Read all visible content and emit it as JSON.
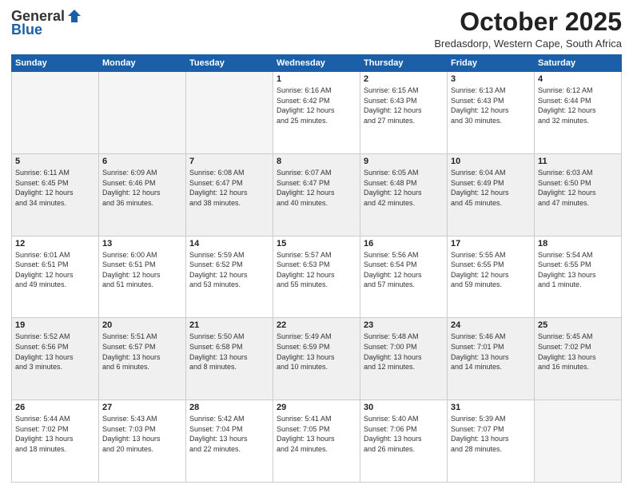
{
  "logo": {
    "line1": "General",
    "line2": "Blue"
  },
  "title": "October 2025",
  "subtitle": "Bredasdorp, Western Cape, South Africa",
  "days_of_week": [
    "Sunday",
    "Monday",
    "Tuesday",
    "Wednesday",
    "Thursday",
    "Friday",
    "Saturday"
  ],
  "weeks": [
    [
      {
        "day": "",
        "info": ""
      },
      {
        "day": "",
        "info": ""
      },
      {
        "day": "",
        "info": ""
      },
      {
        "day": "1",
        "info": "Sunrise: 6:16 AM\nSunset: 6:42 PM\nDaylight: 12 hours\nand 25 minutes."
      },
      {
        "day": "2",
        "info": "Sunrise: 6:15 AM\nSunset: 6:43 PM\nDaylight: 12 hours\nand 27 minutes."
      },
      {
        "day": "3",
        "info": "Sunrise: 6:13 AM\nSunset: 6:43 PM\nDaylight: 12 hours\nand 30 minutes."
      },
      {
        "day": "4",
        "info": "Sunrise: 6:12 AM\nSunset: 6:44 PM\nDaylight: 12 hours\nand 32 minutes."
      }
    ],
    [
      {
        "day": "5",
        "info": "Sunrise: 6:11 AM\nSunset: 6:45 PM\nDaylight: 12 hours\nand 34 minutes."
      },
      {
        "day": "6",
        "info": "Sunrise: 6:09 AM\nSunset: 6:46 PM\nDaylight: 12 hours\nand 36 minutes."
      },
      {
        "day": "7",
        "info": "Sunrise: 6:08 AM\nSunset: 6:47 PM\nDaylight: 12 hours\nand 38 minutes."
      },
      {
        "day": "8",
        "info": "Sunrise: 6:07 AM\nSunset: 6:47 PM\nDaylight: 12 hours\nand 40 minutes."
      },
      {
        "day": "9",
        "info": "Sunrise: 6:05 AM\nSunset: 6:48 PM\nDaylight: 12 hours\nand 42 minutes."
      },
      {
        "day": "10",
        "info": "Sunrise: 6:04 AM\nSunset: 6:49 PM\nDaylight: 12 hours\nand 45 minutes."
      },
      {
        "day": "11",
        "info": "Sunrise: 6:03 AM\nSunset: 6:50 PM\nDaylight: 12 hours\nand 47 minutes."
      }
    ],
    [
      {
        "day": "12",
        "info": "Sunrise: 6:01 AM\nSunset: 6:51 PM\nDaylight: 12 hours\nand 49 minutes."
      },
      {
        "day": "13",
        "info": "Sunrise: 6:00 AM\nSunset: 6:51 PM\nDaylight: 12 hours\nand 51 minutes."
      },
      {
        "day": "14",
        "info": "Sunrise: 5:59 AM\nSunset: 6:52 PM\nDaylight: 12 hours\nand 53 minutes."
      },
      {
        "day": "15",
        "info": "Sunrise: 5:57 AM\nSunset: 6:53 PM\nDaylight: 12 hours\nand 55 minutes."
      },
      {
        "day": "16",
        "info": "Sunrise: 5:56 AM\nSunset: 6:54 PM\nDaylight: 12 hours\nand 57 minutes."
      },
      {
        "day": "17",
        "info": "Sunrise: 5:55 AM\nSunset: 6:55 PM\nDaylight: 12 hours\nand 59 minutes."
      },
      {
        "day": "18",
        "info": "Sunrise: 5:54 AM\nSunset: 6:55 PM\nDaylight: 13 hours\nand 1 minute."
      }
    ],
    [
      {
        "day": "19",
        "info": "Sunrise: 5:52 AM\nSunset: 6:56 PM\nDaylight: 13 hours\nand 3 minutes."
      },
      {
        "day": "20",
        "info": "Sunrise: 5:51 AM\nSunset: 6:57 PM\nDaylight: 13 hours\nand 6 minutes."
      },
      {
        "day": "21",
        "info": "Sunrise: 5:50 AM\nSunset: 6:58 PM\nDaylight: 13 hours\nand 8 minutes."
      },
      {
        "day": "22",
        "info": "Sunrise: 5:49 AM\nSunset: 6:59 PM\nDaylight: 13 hours\nand 10 minutes."
      },
      {
        "day": "23",
        "info": "Sunrise: 5:48 AM\nSunset: 7:00 PM\nDaylight: 13 hours\nand 12 minutes."
      },
      {
        "day": "24",
        "info": "Sunrise: 5:46 AM\nSunset: 7:01 PM\nDaylight: 13 hours\nand 14 minutes."
      },
      {
        "day": "25",
        "info": "Sunrise: 5:45 AM\nSunset: 7:02 PM\nDaylight: 13 hours\nand 16 minutes."
      }
    ],
    [
      {
        "day": "26",
        "info": "Sunrise: 5:44 AM\nSunset: 7:02 PM\nDaylight: 13 hours\nand 18 minutes."
      },
      {
        "day": "27",
        "info": "Sunrise: 5:43 AM\nSunset: 7:03 PM\nDaylight: 13 hours\nand 20 minutes."
      },
      {
        "day": "28",
        "info": "Sunrise: 5:42 AM\nSunset: 7:04 PM\nDaylight: 13 hours\nand 22 minutes."
      },
      {
        "day": "29",
        "info": "Sunrise: 5:41 AM\nSunset: 7:05 PM\nDaylight: 13 hours\nand 24 minutes."
      },
      {
        "day": "30",
        "info": "Sunrise: 5:40 AM\nSunset: 7:06 PM\nDaylight: 13 hours\nand 26 minutes."
      },
      {
        "day": "31",
        "info": "Sunrise: 5:39 AM\nSunset: 7:07 PM\nDaylight: 13 hours\nand 28 minutes."
      },
      {
        "day": "",
        "info": ""
      }
    ]
  ]
}
